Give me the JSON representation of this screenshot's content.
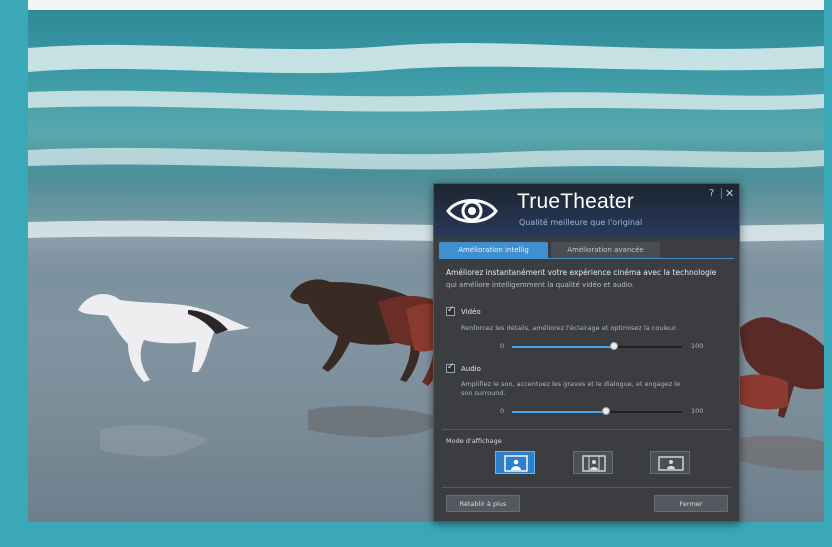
{
  "dialog": {
    "title": "TrueTheater",
    "subtitle": "Qualité meilleure que l'original",
    "help_glyph": "?",
    "close_glyph": "✕",
    "tabs": [
      {
        "label": "Amélioration intellig",
        "active": true
      },
      {
        "label": "Amélioration avancée",
        "active": false
      }
    ],
    "description_line1": "Améliorez instantanément votre expérience cinéma avec la technologie",
    "description_line2": "qui améliore intelligemment la qualité vidéo et audio.",
    "video": {
      "label": "Vidéo",
      "checked": true,
      "description": "Renforcez les détails, améliorez l'éclairage et optimisez la couleur.",
      "slider": {
        "min_label": "0",
        "max_label": "100",
        "value": 60
      }
    },
    "audio": {
      "label": "Audio",
      "checked": true,
      "description_line1": "Amplifiez le son, accentuez les graves et le dialogue, et engagez le",
      "description_line2": "son surround.",
      "slider": {
        "min_label": "0",
        "max_label": "100",
        "value": 55
      }
    },
    "display_mode_label": "Mode d'affichage",
    "display_modes": [
      {
        "icon": "display-mode-standard-icon",
        "active": true
      },
      {
        "icon": "display-mode-portrait-icon",
        "active": false
      },
      {
        "icon": "display-mode-widescreen-icon",
        "active": false
      }
    ],
    "reset_button": "Rétablir à plus",
    "close_button": "Fermer"
  },
  "colors": {
    "frame_teal": "#3aa8b6",
    "dialog_bg": "#3b3d41",
    "accent_blue": "#3f8fd1",
    "slider_fill": "#4aa3e8"
  }
}
